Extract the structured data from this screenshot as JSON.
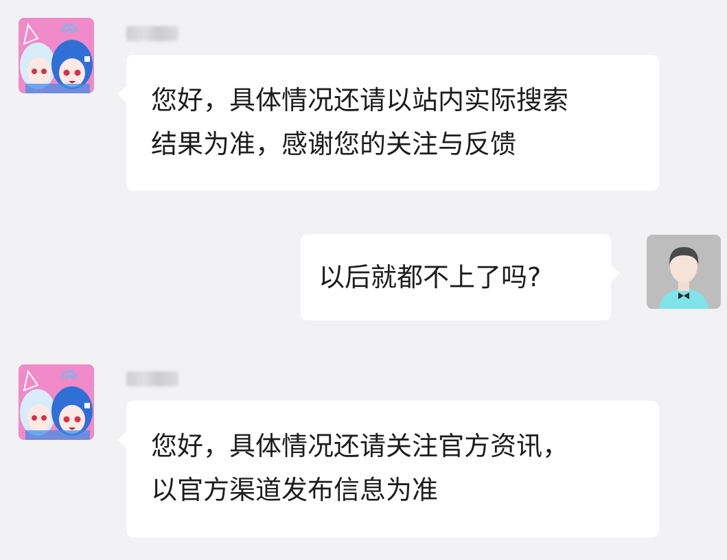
{
  "conversation": {
    "messages": [
      {
        "sender": "agent",
        "avatar": "anime-characters-avatar",
        "lines": [
          "您好，具体情况还请以站内实际搜索",
          "结果为准，感谢您的关注与反馈"
        ]
      },
      {
        "sender": "user",
        "avatar": "default-user-avatar",
        "lines": [
          "以后就都不上了吗?"
        ]
      },
      {
        "sender": "agent",
        "avatar": "anime-characters-avatar",
        "lines": [
          "您好，具体情况还请关注官方资讯，",
          "以官方渠道发布信息为准"
        ]
      }
    ]
  },
  "colors": {
    "background": "#f2f2f4",
    "bubble": "#ffffff",
    "text": "#1c1c1c",
    "agent_avatar_bg": "#f08ac8",
    "user_avatar_bg": "#bdbdbd",
    "user_shirt": "#7fe3ea"
  }
}
